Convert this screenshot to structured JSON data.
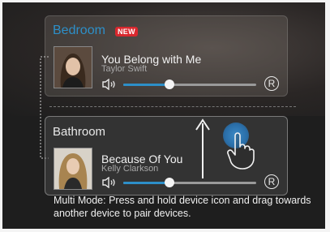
{
  "rooms": [
    {
      "name": "Bedroom",
      "badge": "NEW",
      "song": "You Belong with Me",
      "artist": "Taylor Swift",
      "volume": 0.35,
      "repeat_label": "R"
    },
    {
      "name": "Bathroom",
      "song": "Because Of You",
      "artist": "Kelly Clarkson",
      "volume": 0.35,
      "repeat_label": "R"
    }
  ],
  "instructions": "Multi Mode: Press and hold device icon and drag towards another device to pair devices.",
  "colors": {
    "accent": "#2d8fc8",
    "badge": "#d9282e",
    "background": "#1e1e1e"
  },
  "icons": [
    "speaker-icon",
    "repeat-icon",
    "hand-pointer-icon",
    "up-arrow-icon"
  ]
}
